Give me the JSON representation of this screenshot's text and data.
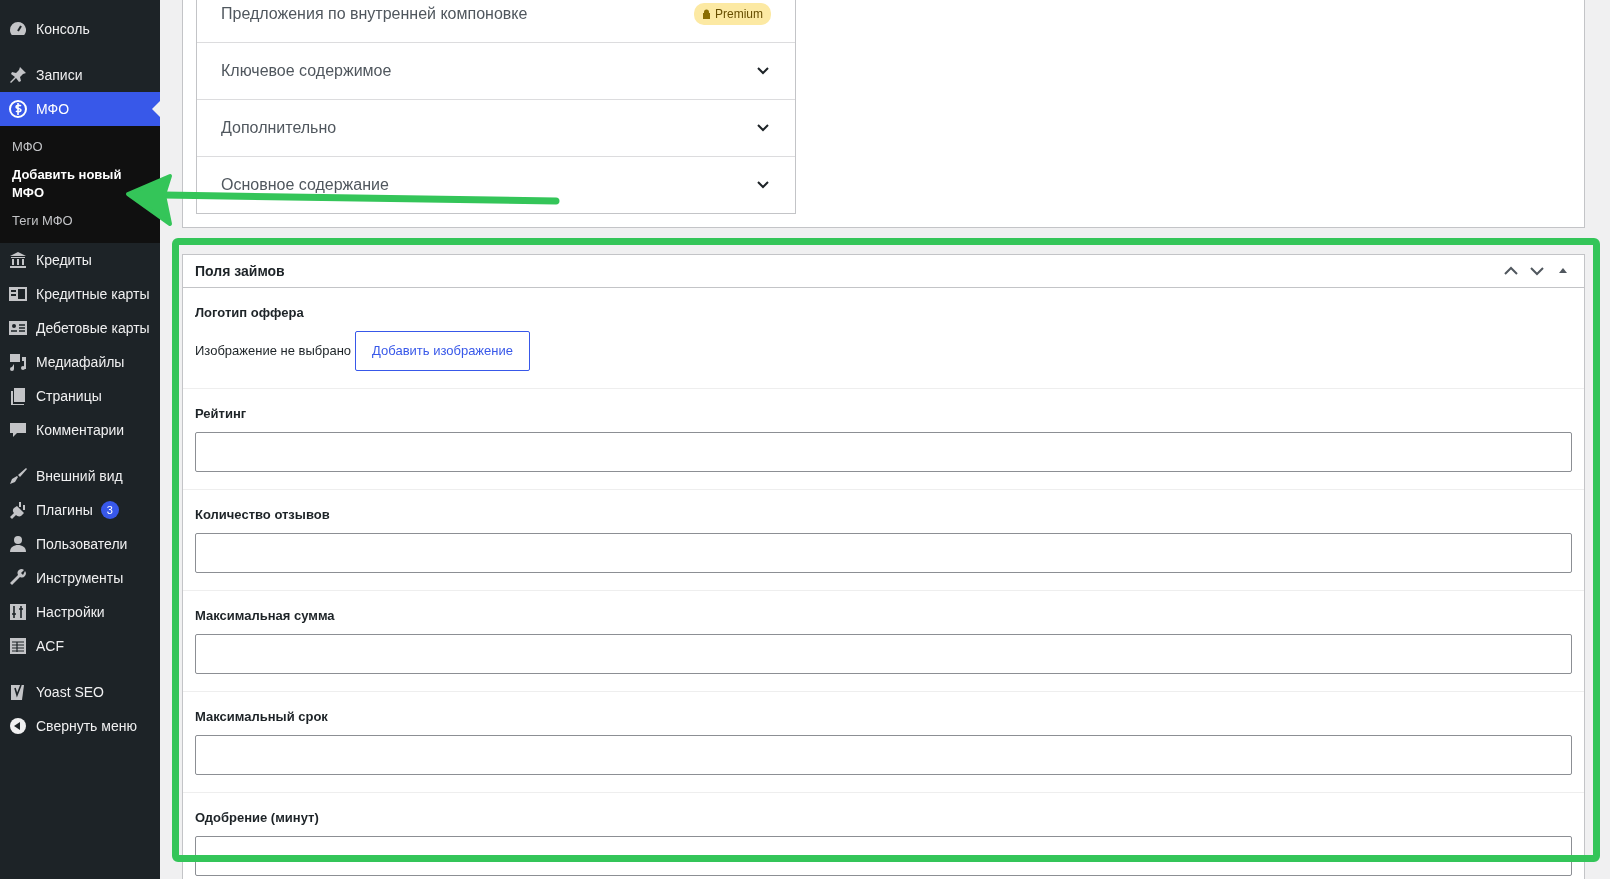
{
  "sidebar": {
    "groups": [
      [
        {
          "label": "Консоль",
          "selected": false
        }
      ],
      [
        {
          "label": "Записи",
          "selected": false
        },
        {
          "label": "МФО",
          "selected": true,
          "children": [
            {
              "label": "МФО",
              "selected": false
            },
            {
              "label": "Добавить новый МФО",
              "selected": true
            },
            {
              "label": "Теги МФО",
              "selected": false
            }
          ]
        },
        {
          "label": "Кредиты",
          "selected": false
        },
        {
          "label": "Кредитные карты",
          "selected": false
        },
        {
          "label": "Дебетовые карты",
          "selected": false
        },
        {
          "label": "Медиафайлы",
          "selected": false
        },
        {
          "label": "Страницы",
          "selected": false
        },
        {
          "label": "Комментарии",
          "selected": false
        }
      ],
      [
        {
          "label": "Внешний вид",
          "selected": false
        },
        {
          "label": "Плагины",
          "selected": false,
          "badge": "3"
        },
        {
          "label": "Пользователи",
          "selected": false
        },
        {
          "label": "Инструменты",
          "selected": false
        },
        {
          "label": "Настройки",
          "selected": false
        },
        {
          "label": "ACF",
          "selected": false
        }
      ],
      [
        {
          "label": "Yoast SEO",
          "selected": false
        },
        {
          "label": "Свернуть меню",
          "selected": false
        }
      ]
    ]
  },
  "seo_panel": {
    "rows": [
      {
        "label": "Предложения по внутренней компоновке",
        "badge": "Premium"
      },
      {
        "label": "Ключевое содержимое",
        "expanded": false
      },
      {
        "label": "Дополнительно",
        "expanded": false
      },
      {
        "label": "Основное содержание",
        "expanded": false
      }
    ]
  },
  "meta_box": {
    "title": "Поля займов",
    "fields": [
      {
        "kind": "image",
        "label": "Логотип оффера",
        "status": "Изображение не выбрано",
        "button": "Добавить изображение"
      },
      {
        "kind": "text",
        "label": "Рейтинг"
      },
      {
        "kind": "text",
        "label": "Количество отзывов"
      },
      {
        "kind": "text",
        "label": "Максимальная сумма"
      },
      {
        "kind": "text",
        "label": "Максимальный срок"
      },
      {
        "kind": "text",
        "label": "Одобрение (минут)"
      }
    ]
  }
}
